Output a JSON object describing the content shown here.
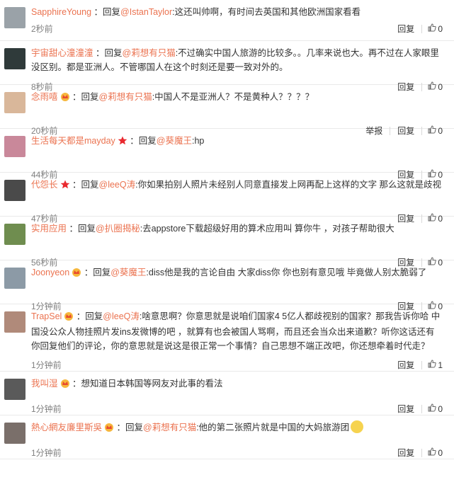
{
  "colors": {
    "accent": "#eb7350",
    "text": "#333333",
    "meta": "#808080"
  },
  "ops": {
    "reply": "回复",
    "report": "举报"
  },
  "comments": [
    {
      "user": "SapphireYoung",
      "badge": "",
      "pre": "：回复",
      "at": "@IstanTaylor",
      "text": ":这还叫帅啊，有时间去英国和其他欧洲国家看看",
      "time": "2秒前",
      "likes": "0",
      "report": false,
      "avatar": "#9aa2a8"
    },
    {
      "user": "宇宙甜心潼潼潼",
      "badge": "",
      "pre": "：回复",
      "at": "@莉想有只猫",
      "text": ":不过确实中国人旅游的比较多。。几率来说也大。再不过在人家眼里没区别。都是亚洲人。不管哪国人在这个时刻还是要一致对外的。",
      "time": "8秒前",
      "likes": "0",
      "report": false,
      "avatar": "#2f3a3a"
    },
    {
      "user": "念雨嘻",
      "badge": "crown",
      "pre": "：回复",
      "at": "@莉想有只猫",
      "text": ":中国人不是亚洲人？不是黄种人？？？？",
      "time": "20秒前",
      "likes": "0",
      "report": true,
      "avatar": "#d9b79a"
    },
    {
      "user": "生活每天都是mayday",
      "badge": "star",
      "pre": "：回复",
      "at": "@葵魔王",
      "text": ":hp",
      "time": "44秒前",
      "likes": "0",
      "report": false,
      "avatar": "#c9889a"
    },
    {
      "user": "代怨长",
      "badge": "star",
      "pre": "：回复",
      "at": "@leeQ涛",
      "text": ":你如果拍别人照片未经别人同意直接发上网再配上这样的文字 那么这就是歧视",
      "time": "47秒前",
      "likes": "0",
      "report": false,
      "avatar": "#4a4a4a"
    },
    {
      "user": "实用应用",
      "badge": "",
      "pre": "：回复",
      "at": "@扒圈揭秘",
      "text": ":去appstore下载超级好用的算术应用叫 算你牛 ，对孩子帮助很大",
      "time": "56秒前",
      "likes": "0",
      "report": false,
      "avatar": "#6f8d4f"
    },
    {
      "user": "Joonyeon",
      "badge": "crown",
      "pre": "：回复",
      "at": "@葵魔王",
      "text": ":diss他是我的言论自由 大家diss你 你也别有意见哦 毕竟做人别太脆弱了",
      "time": "1分钟前",
      "likes": "0",
      "report": false,
      "avatar": "#8c9aa6"
    },
    {
      "user": "TrapSel",
      "badge": "crown",
      "pre": "：回复",
      "at": "@leeQ涛",
      "text": ":啥意思啊？你意思就是说咱们国家4 5亿人都歧视别的国家？那我告诉你哈 中国没公众人物挂照片发ins发微博的吧 ，就算有也会被国人骂啊，而且还会当众出来道歉？听你这话还有你回复他们的评论，你的意思就是说这是很正常一个事情？自己思想不端正改吧，你还想牵着时代走？",
      "time": "1分钟前",
      "likes": "1",
      "report": false,
      "avatar": "#b08a7a"
    },
    {
      "user": "我叫湿",
      "badge": "crown",
      "pre": "：",
      "at": "",
      "text": "想知道日本韩国等网友对此事的看法",
      "time": "1分钟前",
      "likes": "0",
      "report": false,
      "avatar": "#5a5a5a"
    },
    {
      "user": "熱心網友廉里斯吳",
      "badge": "crown",
      "pre": "：回复",
      "at": "@莉想有只猫",
      "text": ":他的第二张照片就是中国的大妈旅游团",
      "time": "1分钟前",
      "likes": "0",
      "report": false,
      "avatar": "#7a6f6a"
    }
  ]
}
